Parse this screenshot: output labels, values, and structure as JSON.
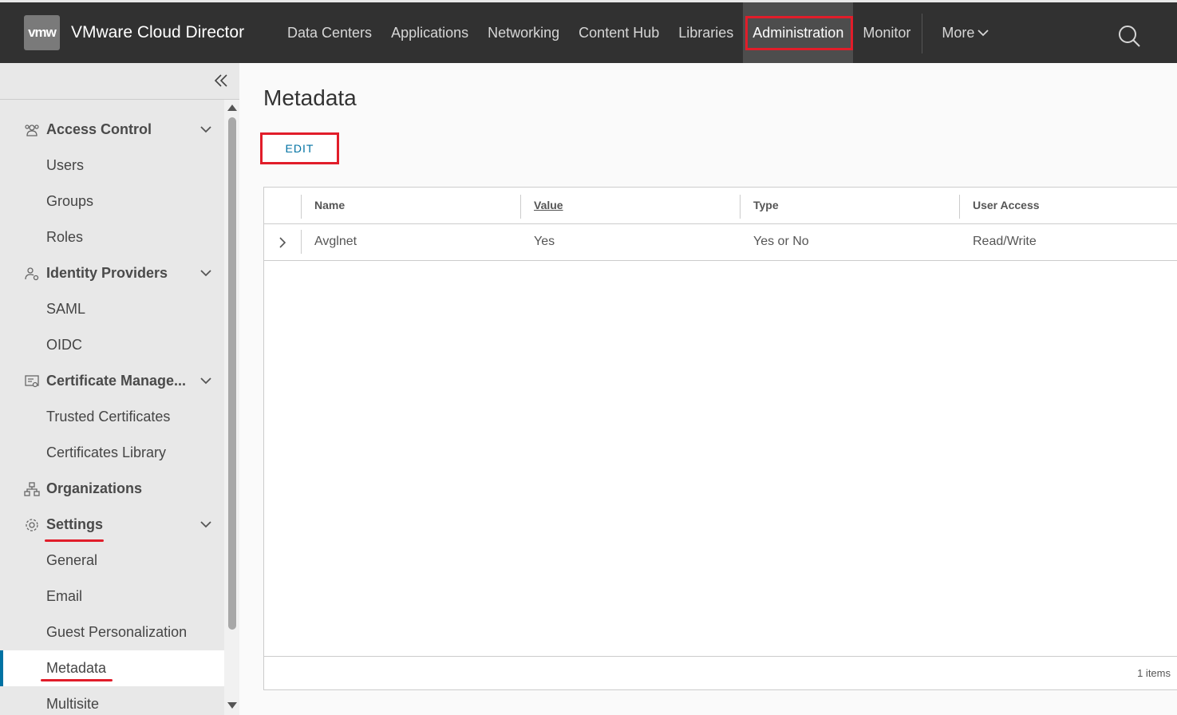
{
  "header": {
    "logo": "vmw",
    "app_title": "VMware Cloud Director",
    "nav": [
      {
        "label": "Data Centers"
      },
      {
        "label": "Applications"
      },
      {
        "label": "Networking"
      },
      {
        "label": "Content Hub"
      },
      {
        "label": "Libraries"
      },
      {
        "label": "Administration",
        "active": true
      },
      {
        "label": "Monitor"
      }
    ],
    "more_label": "More",
    "search_icon": "search-icon"
  },
  "sidebar": {
    "collapse_icon": "double-chevron-left-icon",
    "items": [
      {
        "label": "Access Control",
        "type": "section",
        "icon": "users-icon"
      },
      {
        "label": "Users",
        "type": "child"
      },
      {
        "label": "Groups",
        "type": "child"
      },
      {
        "label": "Roles",
        "type": "child"
      },
      {
        "label": "Identity Providers",
        "type": "section",
        "icon": "identity-icon"
      },
      {
        "label": "SAML",
        "type": "child"
      },
      {
        "label": "OIDC",
        "type": "child"
      },
      {
        "label": "Certificate Manage...",
        "type": "section",
        "icon": "certificate-icon"
      },
      {
        "label": "Trusted Certificates",
        "type": "child"
      },
      {
        "label": "Certificates Library",
        "type": "child"
      },
      {
        "label": "Organizations",
        "type": "section",
        "icon": "organization-icon"
      },
      {
        "label": "Settings",
        "type": "section",
        "icon": "gear-icon"
      },
      {
        "label": "General",
        "type": "child"
      },
      {
        "label": "Email",
        "type": "child"
      },
      {
        "label": "Guest Personalization",
        "type": "child"
      },
      {
        "label": "Metadata",
        "type": "child",
        "selected": true
      },
      {
        "label": "Multisite",
        "type": "child"
      }
    ]
  },
  "main": {
    "title": "Metadata",
    "edit_label": "EDIT",
    "grid": {
      "columns": [
        "Name",
        "Value",
        "Type",
        "User Access"
      ],
      "rows": [
        {
          "name": "Avglnet",
          "value": "Yes",
          "type": "Yes or No",
          "access": "Read/Write"
        }
      ],
      "footer": "1 items"
    }
  },
  "colors": {
    "header_bg": "#313131",
    "accent": "#0072a3",
    "highlight": "#e11d2a"
  }
}
